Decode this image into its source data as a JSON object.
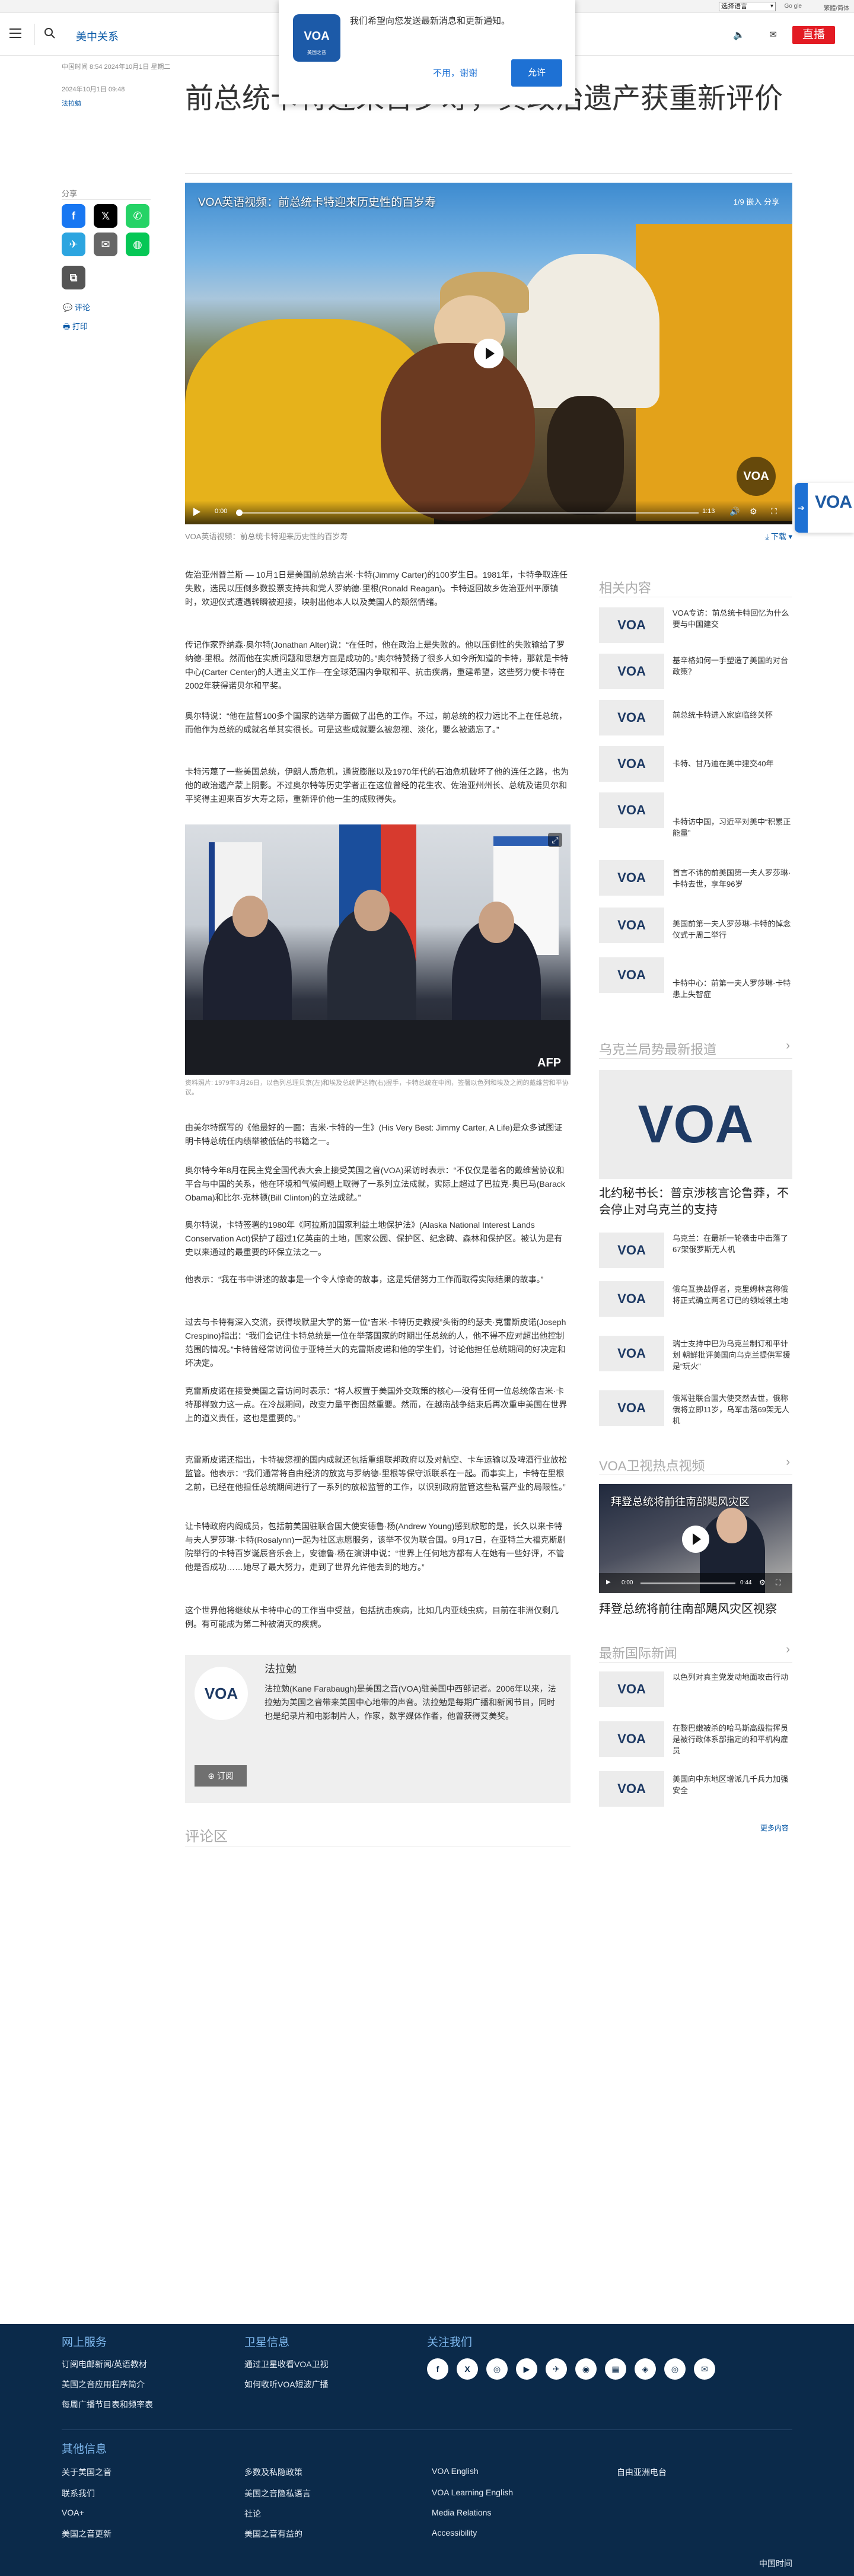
{
  "utility": {
    "language_select": "选择语言",
    "google_label": "Go gle",
    "font_toggle": "繁體/简体"
  },
  "header": {
    "section": "美中关系",
    "live_label": "直播"
  },
  "notification": {
    "message": "我们希望向您发送最新消息和更新通知。",
    "logo_text": "VOA",
    "logo_sub": "美国之音",
    "decline": "不用，谢谢",
    "accept": "允许"
  },
  "meta": {
    "dateline": "中国时间 8:54 2024年10月1日 星期二",
    "date": "2024年10月1日 09:48",
    "author": "法拉勉"
  },
  "article": {
    "title": "前总统卡特迎来百岁寿，其政治遗产获重新评价",
    "share_label": "分享",
    "comment_link": "评论",
    "print_link": "打印",
    "video": {
      "title": "VOA英语视频：前总统卡特迎来历史性的百岁寿",
      "top_right": "1/9  嵌入  分享",
      "time_current": "0:00",
      "time_total": "1:13",
      "watermark": "VOA",
      "caption": "VOA英语视频：前总统卡特迎来历史性的百岁寿",
      "download": "下载"
    },
    "paragraphs_a": [
      "佐治亚州普兰斯 — 10月1日是美国前总统吉米·卡特(Jimmy Carter)的100岁生日。1981年，卡特争取连任失败，选民以压倒多数投票支持共和党人罗纳德·里根(Ronald Reagan)。卡特返回故乡佐治亚州平原镇时，欢迎仪式遭遇转瞬被迎接，映射出他本人以及美国人的颓然情绪。",
      "传记作家乔纳森·奥尔特(Jonathan Alter)说：“在任时，他在政治上是失败的。他以压倒性的失败输给了罗纳德·里根。然而他在实质问题和思想方面是成功的。”奥尔特赞扬了很多人如今所知道的卡特，那就是卡特中心(Carter Center)的人道主义工作—在全球范围内争取和平、抗击疾病，重建希望，这些努力使卡特在2002年获得诺贝尔和平奖。",
      "奥尔特说：“他在监督100多个国家的选举方面做了出色的工作。不过，前总统的权力远比不上在任总统，而他作为总统的成就名单其实很长。可是这些成就要么被忽视、淡化，要么被遗忘了。”",
      "卡特污蔑了一些美国总统，伊朗人质危机，通货膨胀以及1970年代的石油危机破坏了他的连任之路，也为他的政治遗产蒙上阴影。不过奥尔特等历史学者正在这位曾经的花生农、佐治亚州州长、总统及诺贝尔和平奖得主迎来百岁大寿之际，重新评价他一生的成败得失。"
    ],
    "photo": {
      "label": "AFP",
      "caption": "资料照片: 1979年3月26日，以色列总理贝京(左)和埃及总统萨达特(右)握手，卡特总统在中间，签署以色列和埃及之间的戴维营和平协议。"
    },
    "paragraphs_b": [
      "由美尔特撰写的《他最好的一面：吉米·卡特的一生》(His Very Best: Jimmy Carter, A Life)是众多试图证明卡特总统任内绩举被低估的书籍之一。",
      "奥尔特今年8月在民主党全国代表大会上接受美国之音(VOA)采访时表示：“不仅仅是著名的戴维营协议和平合与中国的关系，他在环境和气候问题上取得了一系列立法成就，实际上超过了巴拉克·奥巴马(Barack Obama)和比尔·克林顿(Bill Clinton)的立法成就。”",
      "奥尔特说，卡特签署的1980年《阿拉斯加国家利益土地保护法》(Alaska National Interest Lands Conservation Act)保护了超过1亿英亩的土地，国家公园、保护区、纪念碑、森林和保护区。被认为是有史以来通过的最重要的环保立法之一。",
      "他表示：“我在书中讲述的故事是一个令人惊奇的故事，这是凭借努力工作而取得实际结果的故事。”",
      "过去与卡特有深入交流，获得埃默里大学的第一位“吉米·卡特历史教授”头衔的约瑟夫·克雷斯皮诺(Joseph Crespino)指出：“我们会记住卡特总统是一位在举落国家的时期出任总统的人，他不得不应对超出他控制范围的情况。”卡特曾经常访问位于亚特兰大的克雷斯皮诺和他的学生们，讨论他担任总统期间的好决定和坏决定。",
      "克雷斯皮诺在接受美国之音访问时表示：“将人权置于美国外交政策的核心—没有任何一位总统像吉米·卡特那样致力这一点。在冷战期间，改变力量平衡固然重要。然而，在越南战争结束后再次重申美国在世界上的道义责任，这也是重要的。”",
      "克雷斯皮诺还指出，卡特被您视的国内成就还包括重组联邦政府以及对航空、卡车运输以及啤酒行业放松监管。他表示：“我们通常将自由经济的放宽与罗纳德·里根等保守派联系在一起。而事实上，卡特在里根之前，已经在他担任总统期间进行了一系列的放松监管的工作，以识别政府监管这些私营产业的局限性。”",
      "让卡特政府内阁成员，包括前美国驻联合国大使安德鲁·杨(Andrew Young)感到欣慰的是，长久以来卡特与夫人罗莎琳·卡特(Rosalynn)一起为社区志愿服务，该举不仅为联合国。9月17日，在亚特兰大福克斯剧院举行的卡特百岁诞辰音乐会上，安德鲁·杨在演讲中说：“世界上任何地方都有人在她有一些好评，不管他是否成功……她尽了最大努力，走到了世界允许他去到的地方。”",
      "这个世界他将继续从卡特中心的工作当中受益，包括抗击疾病，比如几内亚线虫病，目前在非洲仅剩几例。有可能成为第二种被消灭的疾病。"
    ]
  },
  "author_box": {
    "avatar": "VOA",
    "name": "法拉勉",
    "bio": "法拉勉(Kane Farabaugh)是美国之音(VOA)驻美国中西部记者。2006年以来，法拉勉为美国之音带来美国中心地带的声音。法拉勉是每期广播和新闻节目，同时也是纪录片和电影制片人，作家，数字媒体作者，他曾获得艾美奖。",
    "subscribe": "订阅"
  },
  "comments_heading": "评论区",
  "sidebar": {
    "related": {
      "heading": "相关内容",
      "items": [
        "VOA专访：前总统卡特回忆为什么要与中国建交",
        "基辛格如何一手塑造了美国的对台政策？",
        "前总统卡特进入家庭临终关怀",
        "卡特、甘乃迪在美中建交40年",
        "卡特访中国，习近平对美中“积累正能量”",
        "首言不讳的前美国第一夫人罗莎琳·卡特去世，享年96岁",
        "美国前第一夫人罗莎琳·卡特的悼念仪式于周二举行",
        "卡特中心：前第一夫人罗莎琳·卡特患上失智症"
      ]
    },
    "ukraine": {
      "heading": "乌克兰局势最新报道",
      "feature": "北约秘书长：普京涉核言论鲁莽，不会停止对乌克兰的支持",
      "items": [
        "乌克兰：在最新一轮袭击中击落了67架俄罗斯无人机",
        "俄乌互换战俘者，克里姆林宫称俄将正式确立两名订已的领域领土地",
        "瑞士支持中巴为乌克兰制订和平计划 朝鲜批评美国向乌克兰提供军援是“玩火”",
        "俄常驻联合国大使突然去世，俄称俄将立即11岁，乌军击落69架无人机"
      ]
    },
    "video_hot": {
      "heading": "VOA卫视热点视频",
      "video_title": "拜登总统将前往南部飓风灾区",
      "caption": "拜登总统将前往南部飓风灾区视察",
      "time_current": "0:00",
      "time_total": "0:44"
    },
    "intl": {
      "heading": "最新国际新闻",
      "items": [
        "以色列对真主党发动地面攻击行动",
        "在黎巴嫩被杀的哈马斯高级指挥员是被行政体系部指定的和平机构雇员",
        "美国向中东地区增派几千兵力加强安全"
      ],
      "more": "更多内容"
    }
  },
  "footer": {
    "col1_heading": "网上服务",
    "col1": [
      "订阅电邮新闻/英语教材",
      "美国之音应用程序简介",
      "每周广播节目表和频率表"
    ],
    "col2_heading": "卫星信息",
    "col2": [
      "通过卫星收看VOA卫视",
      "如何收听VOA短波广播"
    ],
    "col3_heading": "关注我们",
    "social": [
      "f",
      "X",
      "◎",
      "▶",
      "✈",
      "◉",
      "▦",
      "◈",
      "◎",
      "✉"
    ],
    "other_heading": "其他信息",
    "links": [
      [
        "关于美国之音",
        "多数及私隐政策",
        "VOA English",
        "自由亚洲电台"
      ],
      [
        "联系我们",
        "美国之音隐私语言",
        "VOA Learning English",
        ""
      ],
      [
        "VOA+",
        "社论",
        "Media Relations",
        ""
      ],
      [
        "美国之音更新",
        "美国之音有益的",
        "Accessibility",
        ""
      ]
    ],
    "copyright": "中国时间"
  },
  "floating": {
    "logo": "VOA"
  }
}
